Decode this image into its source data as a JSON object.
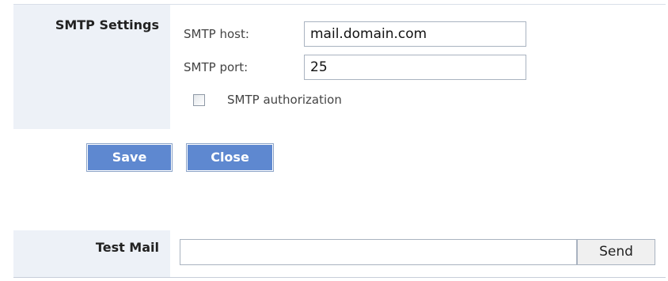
{
  "smtp_settings": {
    "section_label": "SMTP Settings",
    "host": {
      "label": "SMTP host:",
      "value": "mail.domain.com"
    },
    "port": {
      "label": "SMTP port:",
      "value": "25"
    },
    "authorization": {
      "label": "SMTP authorization",
      "checked": false
    }
  },
  "actions": {
    "save_label": "Save",
    "close_label": "Close"
  },
  "test_mail": {
    "section_label": "Test Mail",
    "value": "",
    "send_label": "Send"
  },
  "colors": {
    "label_panel_bg": "#edf1f7",
    "primary_button_bg": "#5e88d0",
    "primary_button_text": "#ffffff",
    "input_border": "#a9b3c0"
  }
}
